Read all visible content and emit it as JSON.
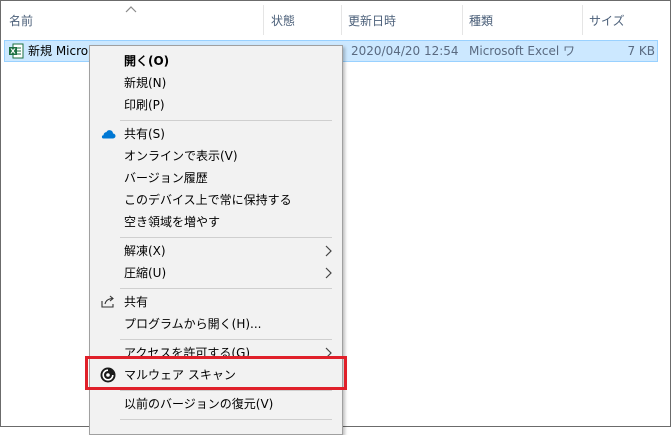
{
  "header": {
    "columns": [
      {
        "label": "名前"
      },
      {
        "label": "状態"
      },
      {
        "label": "更新日時"
      },
      {
        "label": "種類"
      },
      {
        "label": "サイズ"
      }
    ]
  },
  "file_row": {
    "name": "新規 Micro",
    "modified": "2020/04/20 12:54",
    "type": "Microsoft Excel ワ",
    "size": "7 KB"
  },
  "context_menu": {
    "items": [
      {
        "label": "開く(O)",
        "bold": true
      },
      {
        "label": "新規(N)"
      },
      {
        "label": "印刷(P)"
      },
      {
        "label": "共有(S)",
        "icon": "onedrive-cloud-icon"
      },
      {
        "label": "オンラインで表示(V)"
      },
      {
        "label": "バージョン履歴"
      },
      {
        "label": "このデバイス上で常に保持する"
      },
      {
        "label": "空き領域を増やす"
      },
      {
        "label": "解凍(X)",
        "submenu": true
      },
      {
        "label": "圧縮(U)",
        "submenu": true
      },
      {
        "label": "共有",
        "icon": "share-icon"
      },
      {
        "label": "プログラムから開く(H)..."
      },
      {
        "label": "アクセスを許可する(G)",
        "submenu": true
      },
      {
        "label": "マルウェア スキャン",
        "icon": "malware-scan-icon"
      },
      {
        "label": "以前のバージョンの復元(V)"
      }
    ]
  },
  "colors": {
    "selection_bg": "#cce8ff",
    "selection_border": "#99d1ff",
    "menu_bg": "#f2f2f2",
    "highlight_box": "#e0202a",
    "header_text": "#4c607a",
    "onedrive_blue": "#0078d4",
    "excel_green": "#1d6f42"
  }
}
